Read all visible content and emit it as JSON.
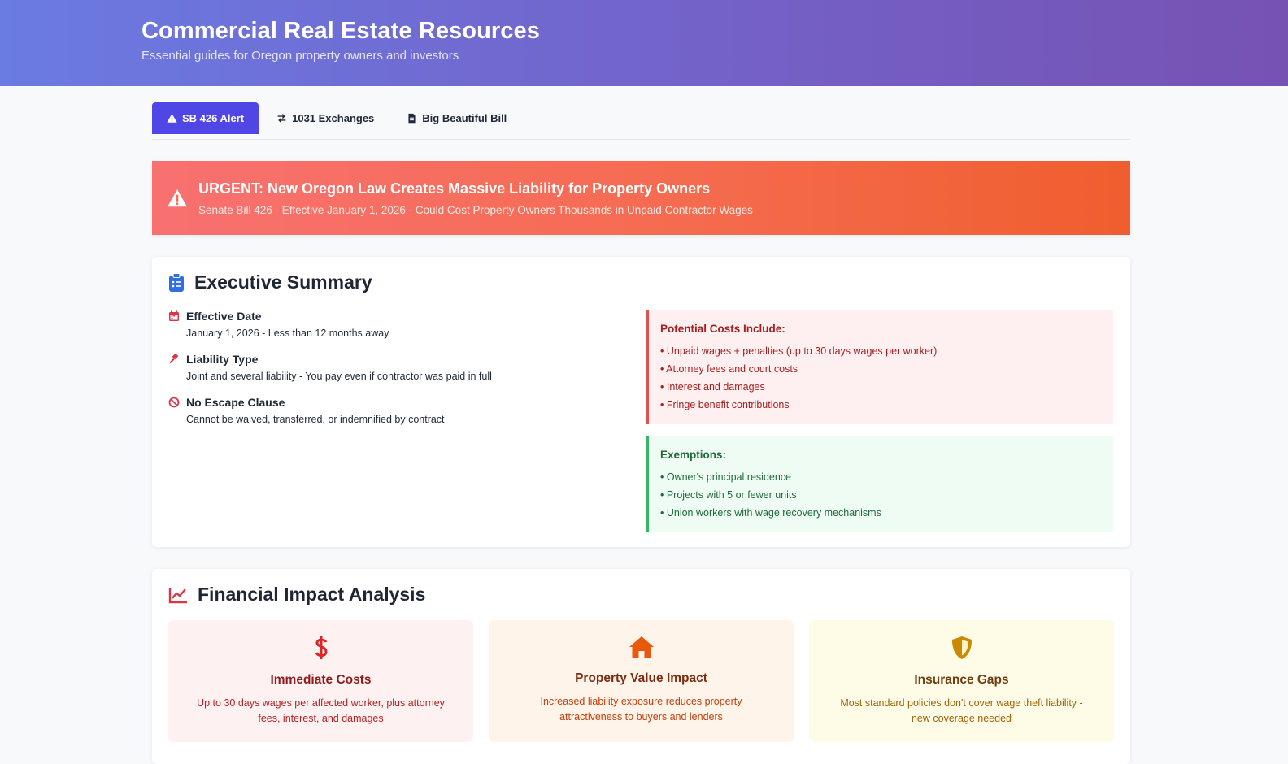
{
  "header": {
    "title": "Commercial Real Estate Resources",
    "subtitle": "Essential guides for Oregon property owners and investors"
  },
  "tabs": [
    {
      "label": "SB 426 Alert",
      "icon": "warning-icon",
      "active": true
    },
    {
      "label": "1031 Exchanges",
      "icon": "exchange-icon",
      "active": false
    },
    {
      "label": "Big Beautiful Bill",
      "icon": "document-icon",
      "active": false
    }
  ],
  "alert": {
    "title": "URGENT: New Oregon Law Creates Massive Liability for Property Owners",
    "subtitle": "Senate Bill 426 - Effective January 1, 2026 - Could Cost Property Owners Thousands in Unpaid Contractor Wages"
  },
  "executive_summary": {
    "title": "Executive Summary",
    "items": [
      {
        "title": "Effective Date",
        "desc": "January 1, 2026 - Less than 12 months away",
        "icon": "calendar-icon"
      },
      {
        "title": "Liability Type",
        "desc": "Joint and several liability - You pay even if contractor was paid in full",
        "icon": "gavel-icon"
      },
      {
        "title": "No Escape Clause",
        "desc": "Cannot be waived, transferred, or indemnified by contract",
        "icon": "ban-icon"
      }
    ],
    "costs": {
      "title": "Potential Costs Include:",
      "items": [
        "• Unpaid wages + penalties (up to 30 days wages per worker)",
        "• Attorney fees and court costs",
        "• Interest and damages",
        "• Fringe benefit contributions"
      ]
    },
    "exemptions": {
      "title": "Exemptions:",
      "items": [
        "• Owner's principal residence",
        "• Projects with 5 or fewer units",
        "• Union workers with wage recovery mechanisms"
      ]
    }
  },
  "financial_impact": {
    "title": "Financial Impact Analysis",
    "cards": [
      {
        "title": "Immediate Costs",
        "desc": "Up to 30 days wages per affected worker, plus attorney fees, interest, and damages",
        "icon": "dollar-icon"
      },
      {
        "title": "Property Value Impact",
        "desc": "Increased liability exposure reduces property attractiveness to buyers and lenders",
        "icon": "home-icon"
      },
      {
        "title": "Insurance Gaps",
        "desc": "Most standard policies don't cover wage theft liability - new coverage needed",
        "icon": "shield-icon"
      }
    ]
  },
  "colors": {
    "accent": "#4f46e5",
    "alert": "#f56b4f",
    "danger": "#e05252",
    "success": "#35b865"
  }
}
